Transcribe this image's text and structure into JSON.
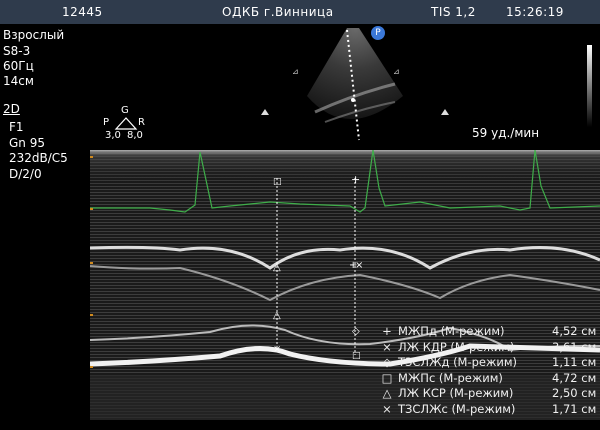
{
  "header": {
    "patient_id": "12445",
    "institution": "ОДКБ г.Винница",
    "tis": "TIS 1,2",
    "time": "15:26:19"
  },
  "left_panel": {
    "mode": "Взрослый",
    "probe": "S8-3",
    "freq": "60Гц",
    "depth": "14см",
    "imaging": "2D",
    "line1": "F1",
    "gain": "Gn 95",
    "dyn": "232dB/C5",
    "line4": "D/2/0"
  },
  "orientation": {
    "g": "G",
    "p": "P",
    "r": "R",
    "left_val": "3,0",
    "right_val": "8,0"
  },
  "probe_badge": "P",
  "heart_rate": "59 уд./мин",
  "measurements": [
    {
      "symbol": "+",
      "label": "МЖПд (М-режим)",
      "value": "4,52 см"
    },
    {
      "symbol": "×",
      "label": "ЛЖ КДР (М-режим)",
      "value": "3,61 см"
    },
    {
      "symbol": "◇",
      "label": "ТЗСЛЖд (М-режим)",
      "value": "1,11 см"
    },
    {
      "symbol": "□",
      "label": "МЖПс (М-режим)",
      "value": "4,72 см"
    },
    {
      "symbol": "△",
      "label": "ЛЖ КСР (М-режим)",
      "value": "2,50 см"
    },
    {
      "symbol": "×",
      "label": "ТЗСЛЖс (М-режим)",
      "value": "1,71 см"
    }
  ],
  "colors": {
    "topbar": "#2f3b4c",
    "ecg": "#3fae4a",
    "probe_badge": "#3b78d8",
    "tick_marker": "#d08a1e"
  }
}
